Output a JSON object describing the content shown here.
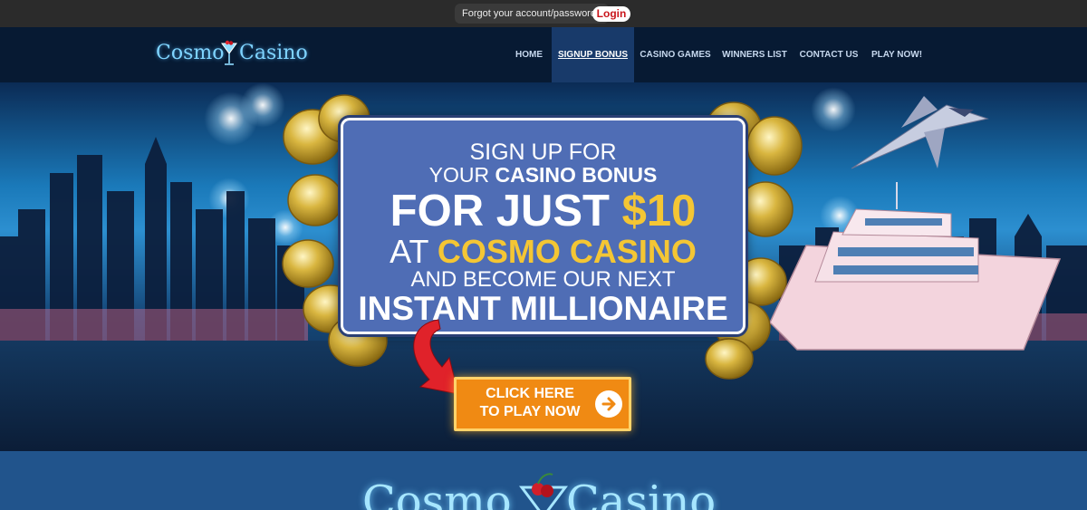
{
  "topbar": {
    "forgot_text": "Forgot your account/password?",
    "login_label": "Login"
  },
  "header": {
    "logo": {
      "left_word": "Cosmo",
      "right_word": "Casino"
    },
    "nav": [
      {
        "label": "HOME"
      },
      {
        "label": "SIGNUP BONUS",
        "active": true
      },
      {
        "label": "CASINO GAMES"
      },
      {
        "label": "WINNERS LIST"
      },
      {
        "label": "CONTACT US"
      },
      {
        "label": "PLAY NOW!"
      }
    ]
  },
  "hero": {
    "promo": {
      "line1": "SIGN UP FOR",
      "line2_prefix": "YOUR ",
      "line2_bold": "CASINO BONUS",
      "line3_prefix": "FOR JUST ",
      "line3_highlight": "$10",
      "line4_prefix": "AT ",
      "line4_highlight": "COSMO CASINO",
      "line5": "AND BECOME OUR NEXT",
      "line6": "INSTANT MILLIONAIRE"
    },
    "cta": {
      "line1": "CLICK HERE",
      "line2": "TO PLAY NOW",
      "icon": "arrow-right-circle-icon"
    }
  },
  "footer_logo": {
    "left_word": "Cosmo",
    "right_word": "Casino"
  },
  "colors": {
    "topbar": "#2b2b2b",
    "header": "#071a33",
    "nav_active": "#183a6a",
    "login_text": "#c9151b",
    "promo_panel": "#4f6db5",
    "highlight_gold": "#f4c634",
    "cta_orange": "#f08a13",
    "bottom_band": "#21548c"
  }
}
